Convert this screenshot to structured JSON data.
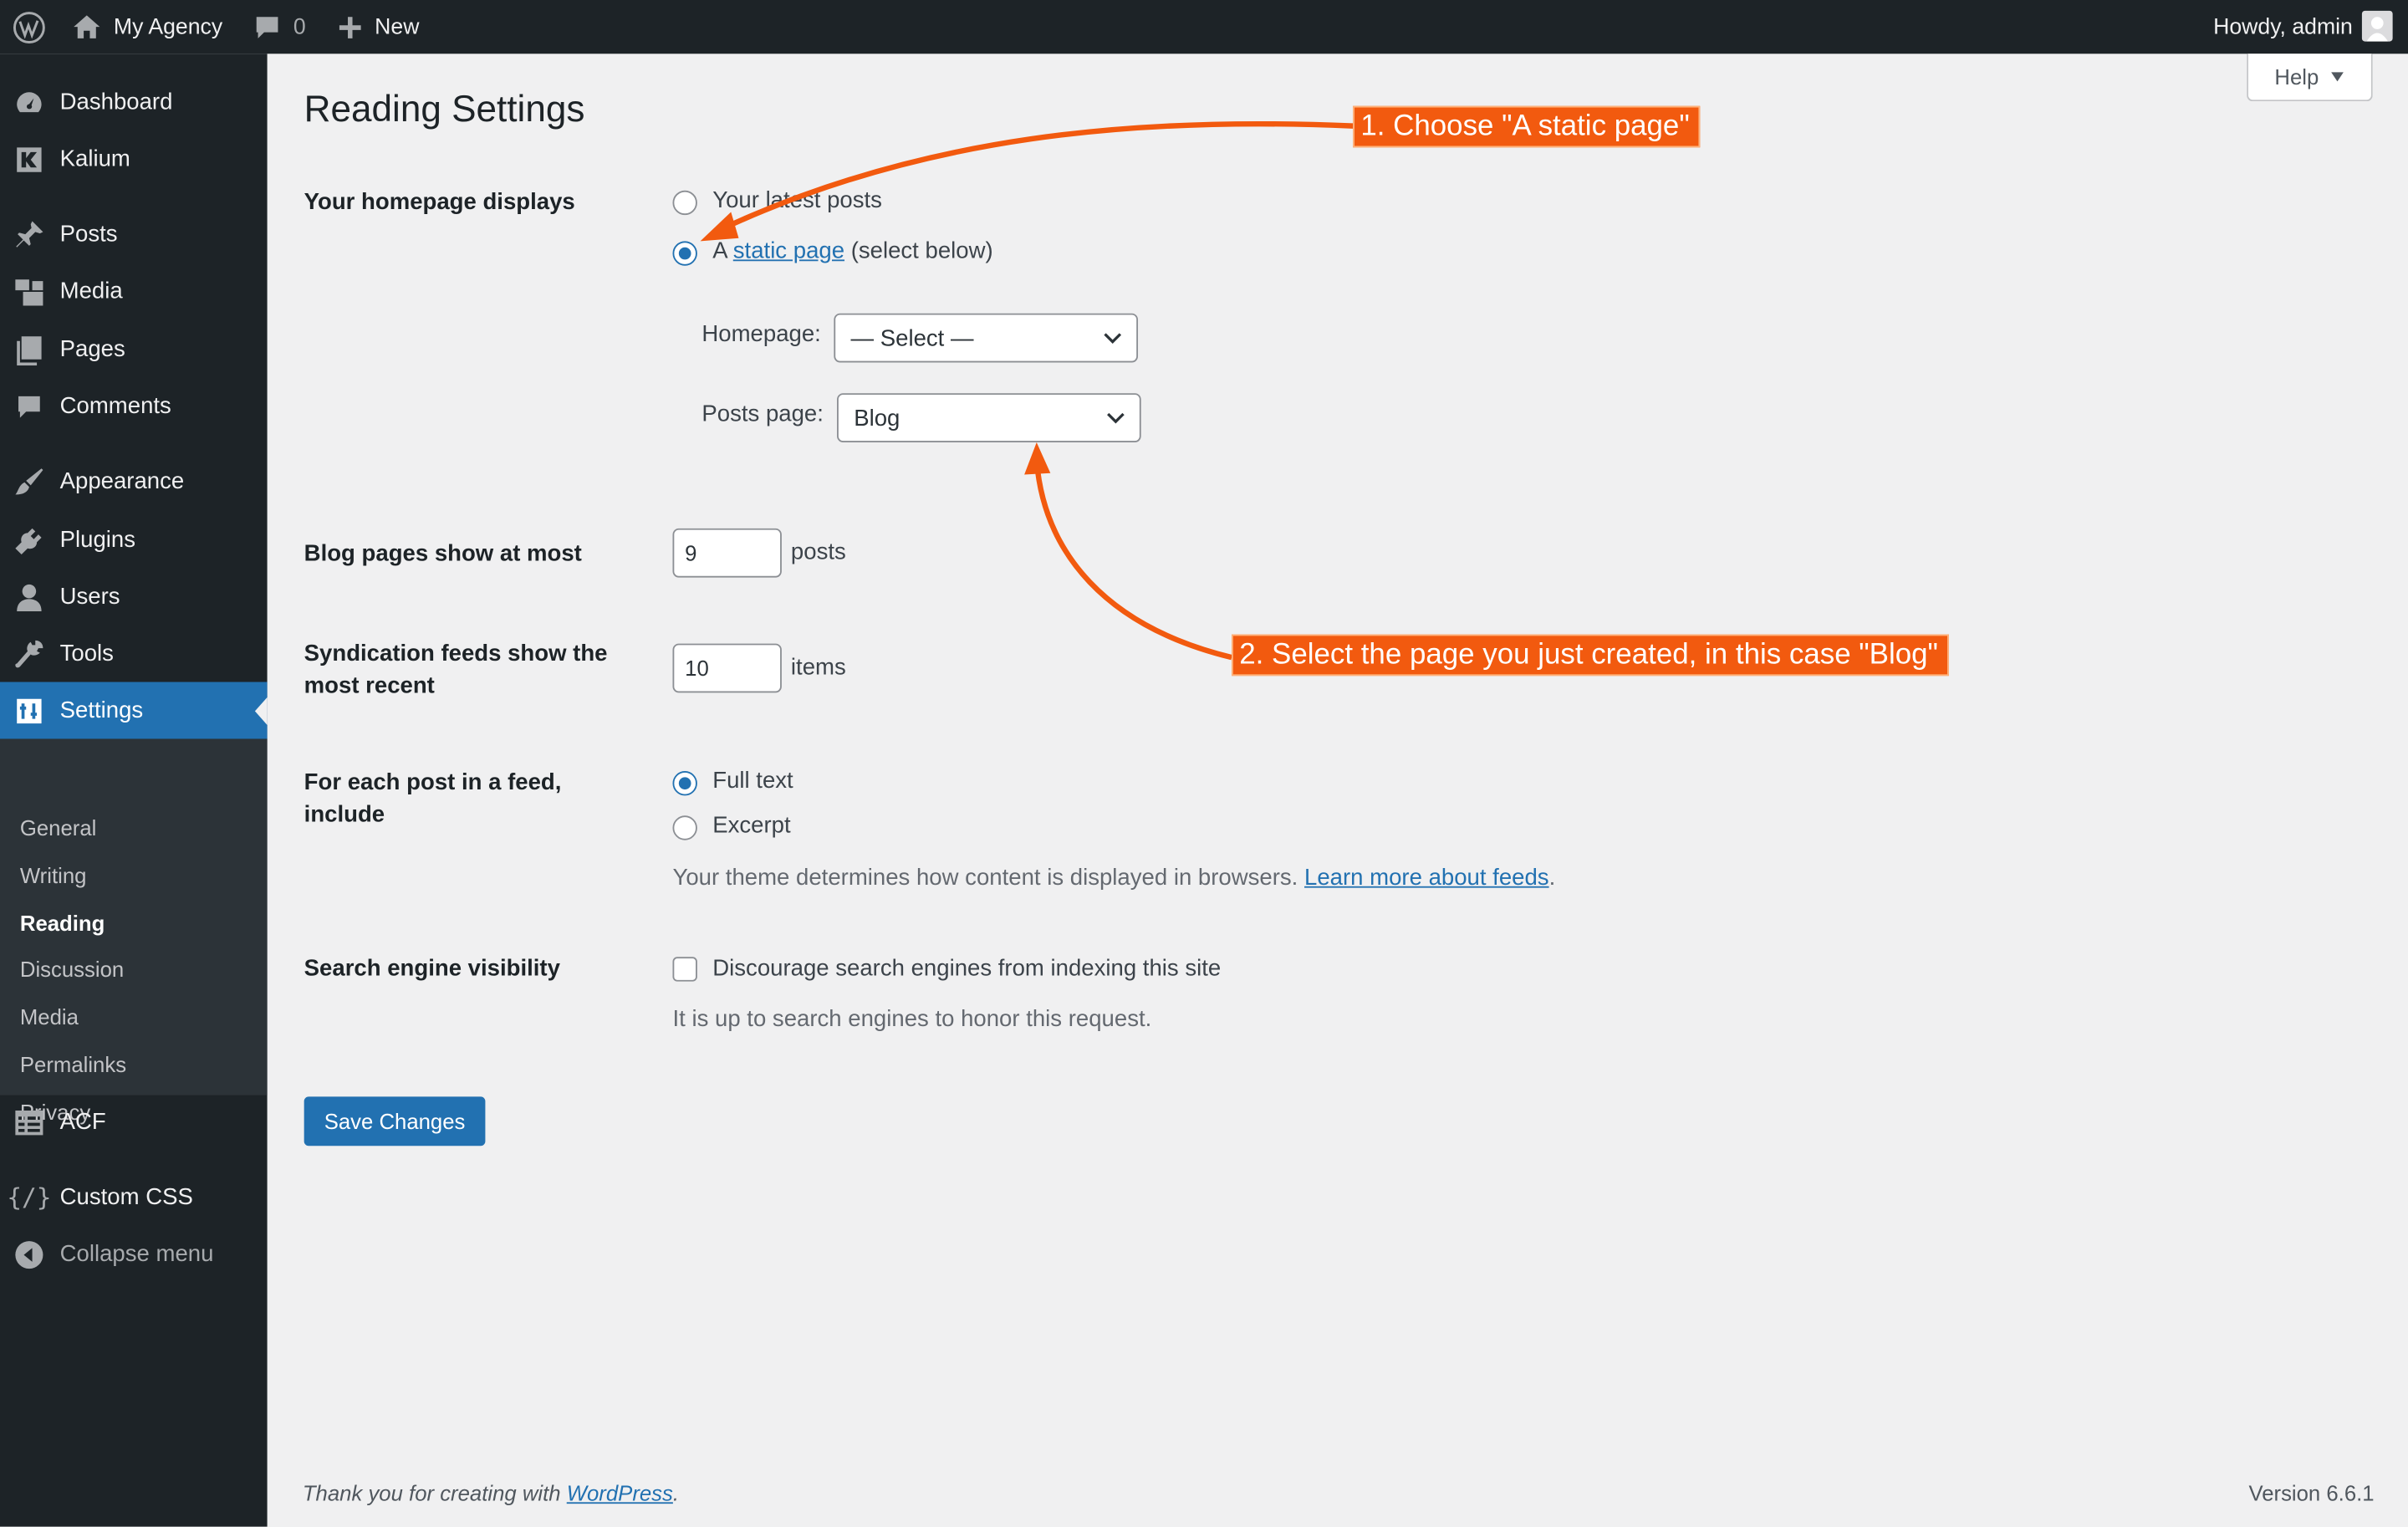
{
  "adminbar": {
    "site_name": "My Agency",
    "comments_count": "0",
    "new_label": "New",
    "howdy": "Howdy, admin"
  },
  "sidebar": {
    "items": [
      {
        "label": "Dashboard",
        "icon": "dashboard-icon"
      },
      {
        "label": "Kalium",
        "icon": "kalium-icon"
      },
      {
        "label": "Posts",
        "icon": "pin-icon"
      },
      {
        "label": "Media",
        "icon": "media-icon"
      },
      {
        "label": "Pages",
        "icon": "pages-icon"
      },
      {
        "label": "Comments",
        "icon": "comment-icon"
      },
      {
        "label": "Appearance",
        "icon": "brush-icon"
      },
      {
        "label": "Plugins",
        "icon": "plug-icon"
      },
      {
        "label": "Users",
        "icon": "user-icon"
      },
      {
        "label": "Tools",
        "icon": "wrench-icon"
      },
      {
        "label": "Settings",
        "icon": "settings-icon"
      },
      {
        "label": "ACF",
        "icon": "acf-icon"
      },
      {
        "label": "Custom CSS",
        "icon": "code-icon"
      },
      {
        "label": "Collapse menu",
        "icon": "collapse-icon"
      }
    ],
    "submenu": [
      "General",
      "Writing",
      "Reading",
      "Discussion",
      "Media",
      "Permalinks",
      "Privacy"
    ]
  },
  "page": {
    "title": "Reading Settings",
    "help": "Help",
    "homepage_displays": {
      "label": "Your homepage displays",
      "option_latest": "Your latest posts",
      "option_static_prefix": "A",
      "option_static_link": "static page",
      "option_static_suffix": "(select below)",
      "selected": "static page"
    },
    "homepage": {
      "label": "Homepage:",
      "value": "— Select —"
    },
    "posts_page": {
      "label": "Posts page:",
      "value": "Blog"
    },
    "blog_pages": {
      "label": "Blog pages show at most",
      "value": "9",
      "unit": "posts"
    },
    "syndication": {
      "label": "Syndication feeds show the most recent",
      "value": "10",
      "unit": "items"
    },
    "feed_include": {
      "label": "For each post in a feed, include",
      "option_full": "Full text",
      "option_excerpt": "Excerpt",
      "selected": "Full text",
      "desc": "Your theme determines how content is displayed in browsers.",
      "desc_link": "Learn more about feeds",
      "desc_end": "."
    },
    "search_visibility": {
      "label": "Search engine visibility",
      "checkbox_label": "Discourage search engines from indexing this site",
      "checked": "false",
      "desc": "It is up to search engines to honor this request."
    },
    "save_label": "Save Changes"
  },
  "footer": {
    "thanks_prefix": "Thank you for creating with",
    "thanks_link": "WordPress",
    "thanks_end": ".",
    "version": "Version 6.6.1"
  },
  "annotations": {
    "step1": "1. Choose \"A static page\"",
    "step2": "2. Select the page you just created, in this case \"Blog\"",
    "color": "#f25a0f"
  },
  "colors": {
    "adminbar": "#1d2327",
    "accent": "#2271b1",
    "background": "#f0f0f1"
  }
}
